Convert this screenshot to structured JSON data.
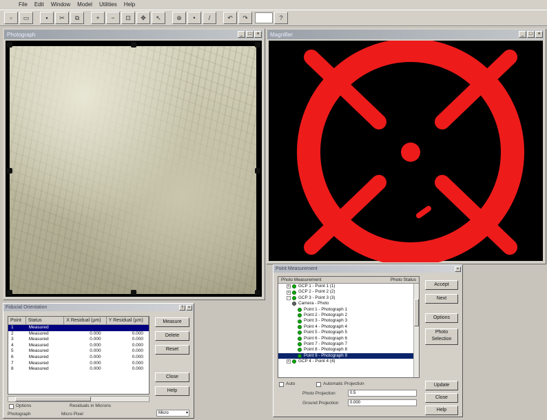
{
  "menu": [
    "File",
    "Edit",
    "Window",
    "Model",
    "Utilities",
    "Help"
  ],
  "toolbar": {
    "buttons": [
      "new",
      "open",
      "save",
      "cut",
      "copy",
      "paste",
      "zoom-in",
      "zoom-out",
      "fit",
      "pan",
      "select",
      "measure",
      "point",
      "line",
      "undo",
      "redo",
      "help"
    ]
  },
  "left_window": {
    "title": "Photograph"
  },
  "right_window": {
    "title": "Magnifier"
  },
  "fiducial_dialog": {
    "title": "Fiducial Orientation",
    "columns": [
      "Point",
      "Status",
      "X Residual (µm)",
      "Y Residual (µm)"
    ],
    "rows": [
      {
        "point": "1",
        "status": "Measured",
        "x": "",
        "y": ""
      },
      {
        "point": "2",
        "status": "Measured",
        "x": "0.000",
        "y": "0.000"
      },
      {
        "point": "3",
        "status": "Measured",
        "x": "0.000",
        "y": "0.000"
      },
      {
        "point": "4",
        "status": "Measured",
        "x": "0.000",
        "y": "0.000"
      },
      {
        "point": "5",
        "status": "Measured",
        "x": "0.000",
        "y": "0.000"
      },
      {
        "point": "6",
        "status": "Measured",
        "x": "0.000",
        "y": "0.000"
      },
      {
        "point": "7",
        "status": "Measured",
        "x": "0.000",
        "y": "0.000"
      },
      {
        "point": "8",
        "status": "Measured",
        "x": "0.000",
        "y": "0.000"
      }
    ],
    "buttons": [
      "Measure",
      "Delete",
      "Reset",
      "Close",
      "Help"
    ],
    "checkbox_label": "Options",
    "status_line": "Residuals in Microns",
    "footer_label": "Photograph",
    "footer_value": "Micro Pixel",
    "select_value": "Micro"
  },
  "point_dialog": {
    "title": "Point Measurement",
    "tree_header_left": "Photo Measurement",
    "tree_header_right": "Photo Status",
    "nodes": [
      {
        "label": "GCP 1 - Point 1 (1)",
        "indent": 1,
        "dot": true,
        "expander": "+"
      },
      {
        "label": "GCP 2 - Point 2 (2)",
        "indent": 1,
        "dot": true,
        "expander": "+"
      },
      {
        "label": "GCP 3 - Point 3 (3)",
        "indent": 1,
        "dot": true,
        "expander": "-"
      },
      {
        "label": "Camera - Photo",
        "indent": 2,
        "dot": "gray",
        "expander": ""
      },
      {
        "label": "Point 1 - Photograph 1",
        "indent": 3,
        "dot": true,
        "expander": ""
      },
      {
        "label": "Point 2 - Photograph 2",
        "indent": 3,
        "dot": true,
        "expander": ""
      },
      {
        "label": "Point 3 - Photograph 3",
        "indent": 3,
        "dot": true,
        "expander": ""
      },
      {
        "label": "Point 4 - Photograph 4",
        "indent": 3,
        "dot": true,
        "expander": ""
      },
      {
        "label": "Point 5 - Photograph 5",
        "indent": 3,
        "dot": true,
        "expander": ""
      },
      {
        "label": "Point 6 - Photograph 6",
        "indent": 3,
        "dot": true,
        "expander": ""
      },
      {
        "label": "Point 7 - Photograph 7",
        "indent": 3,
        "dot": true,
        "expander": ""
      },
      {
        "label": "Point 8 - Photograph 8",
        "indent": 3,
        "dot": true,
        "expander": ""
      },
      {
        "label": "Point 9 - Photograph 9",
        "indent": 3,
        "dot": true,
        "expander": ""
      },
      {
        "label": "GCP 4 - Point 4 (4)",
        "indent": 1,
        "dot": true,
        "expander": "+"
      }
    ],
    "buttons_right": [
      "Accept",
      "Next",
      "Options",
      "Photo Selection"
    ],
    "buttons_bottom": [
      "Update",
      "Close",
      "Help"
    ],
    "auto_label": "Auto",
    "auto_project_label": "Automatic Projection",
    "field1_label": "Photo Projection",
    "field1_value": "0.5",
    "field2_label": "Ground Projection",
    "field2_value": "0.000"
  }
}
